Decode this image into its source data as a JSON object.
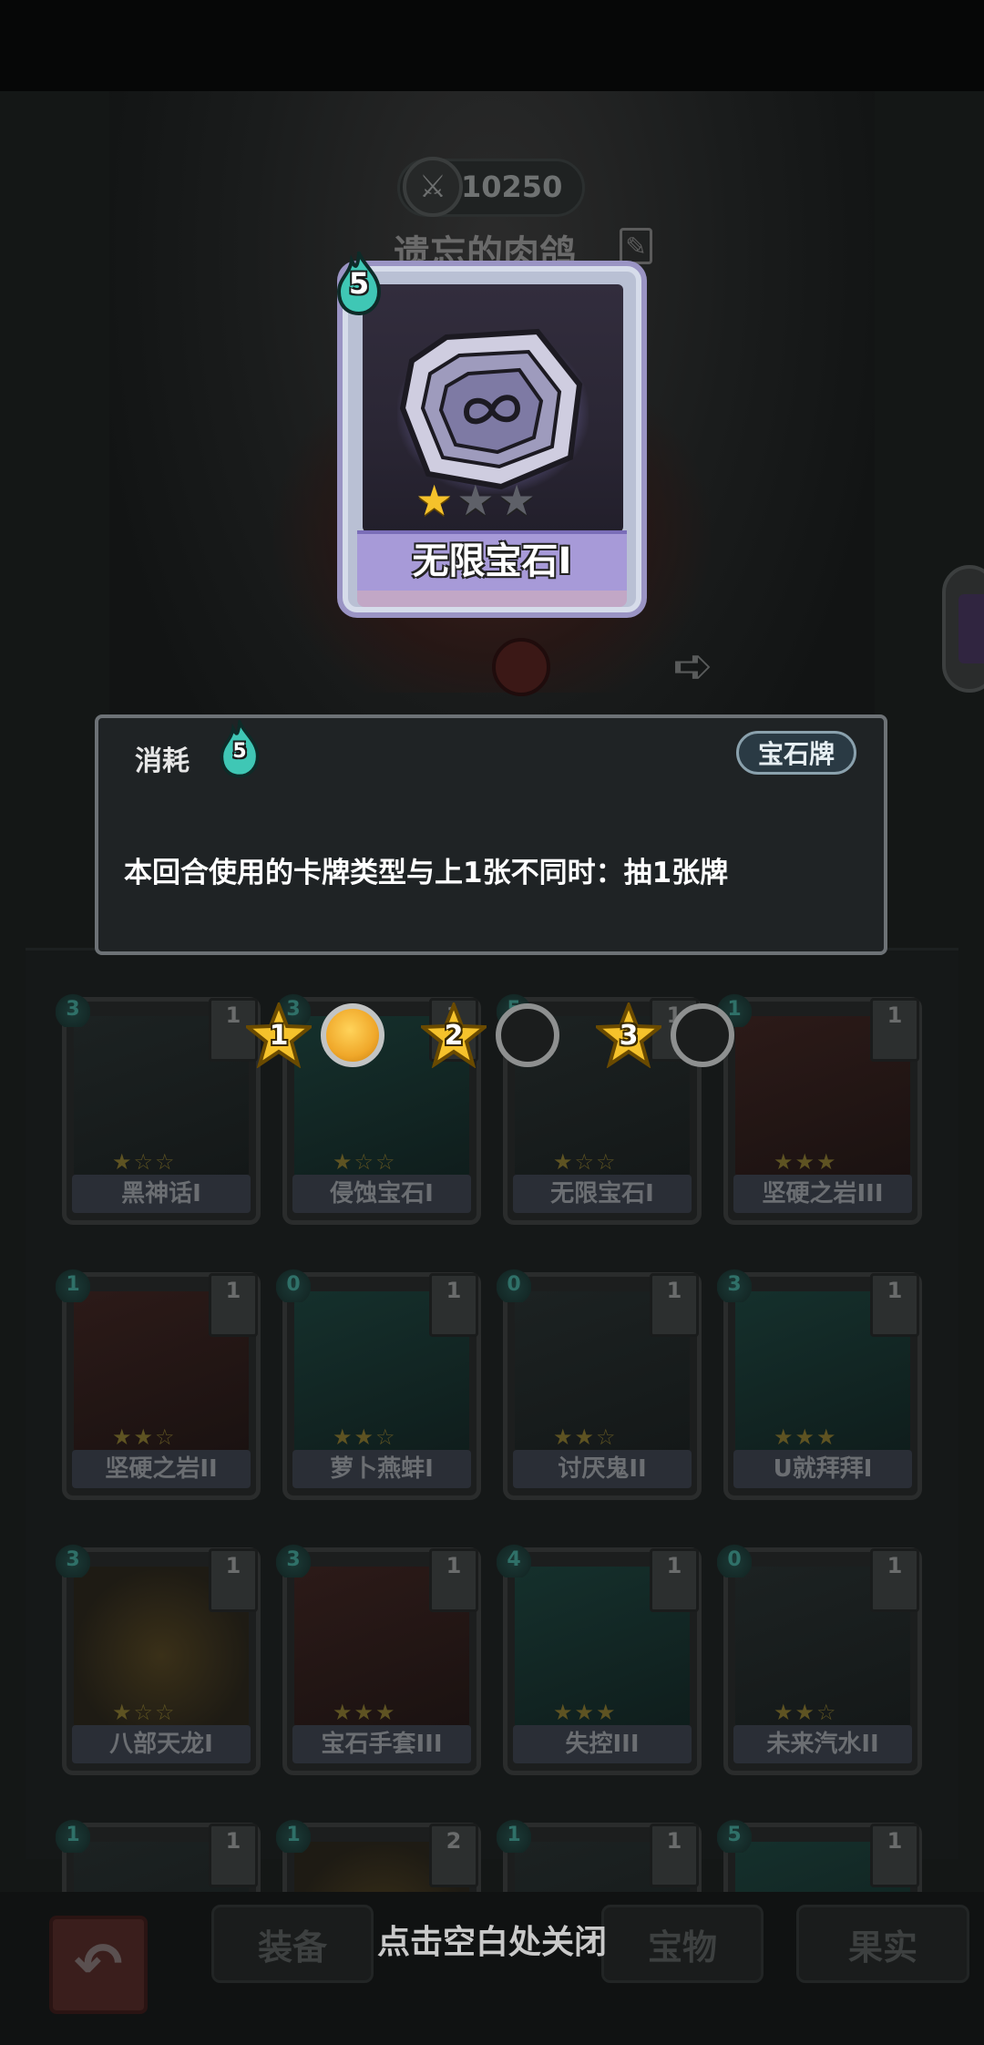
{
  "header": {
    "score": "10250",
    "player_name": "遗忘的肉鸽"
  },
  "featured_card": {
    "name": "无限宝石I",
    "cost": "5",
    "stars_filled": 1,
    "stars_total": 3
  },
  "tooltip": {
    "cost_label": "消耗",
    "cost_value": "5",
    "type_badge": "宝石牌",
    "description": "本回合使用的卡牌类型与上1张不同时：抽1张牌"
  },
  "progress": {
    "steps": [
      "1",
      "2",
      "3"
    ],
    "filled": [
      true,
      false,
      false
    ]
  },
  "deck": {
    "cards": [
      {
        "name": "黑神话I",
        "cost": "3",
        "count": "1"
      },
      {
        "name": "侵蚀宝石I",
        "cost": "3",
        "count": "1"
      },
      {
        "name": "无限宝石I",
        "cost": "5",
        "count": "1"
      },
      {
        "name": "坚硬之岩III",
        "cost": "1",
        "count": "1"
      },
      {
        "name": "坚硬之岩II",
        "cost": "1",
        "count": "1"
      },
      {
        "name": "萝卜燕蚌I",
        "cost": "0",
        "count": "1"
      },
      {
        "name": "讨厌鬼II",
        "cost": "0",
        "count": "1"
      },
      {
        "name": "U就拜拜I",
        "cost": "3",
        "count": "1"
      },
      {
        "name": "八部天龙I",
        "cost": "3",
        "count": "1"
      },
      {
        "name": "宝石手套III",
        "cost": "3",
        "count": "1"
      },
      {
        "name": "失控III",
        "cost": "4",
        "count": "1"
      },
      {
        "name": "未来汽水II",
        "cost": "0",
        "count": "1"
      },
      {
        "name": "",
        "cost": "1",
        "count": "1"
      },
      {
        "name": "",
        "cost": "1",
        "count": "2"
      },
      {
        "name": "",
        "cost": "1",
        "count": "1"
      },
      {
        "name": "",
        "cost": "5",
        "count": "1"
      }
    ]
  },
  "bottom_nav": {
    "tabs": [
      "装备",
      "宝物",
      "果实"
    ],
    "close_hint": "点击空白处关闭"
  },
  "colors": {
    "star_filled": "#f5c22b",
    "progress_filled": "#f0a82a",
    "cost_flame": "#3fc7b5",
    "card_name_bar": "#a79ad8"
  }
}
